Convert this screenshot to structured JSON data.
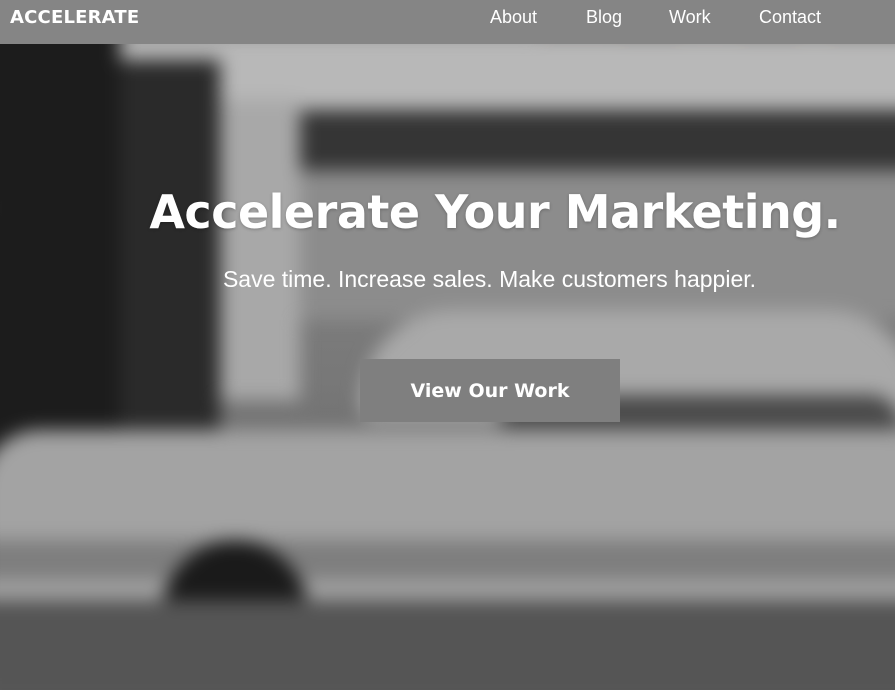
{
  "brand": {
    "name": "ACCELERATE"
  },
  "nav": {
    "items": [
      {
        "label": "About"
      },
      {
        "label": "Blog"
      },
      {
        "label": "Work"
      },
      {
        "label": "Contact"
      }
    ]
  },
  "hero": {
    "title": "Accelerate Your Marketing.",
    "subtitle": "Save time. Increase sales. Make customers happier.",
    "cta_label": "View Our Work"
  },
  "colors": {
    "navbar_bg": "#858585",
    "button_bg": "#7f7f7f",
    "text": "#ffffff"
  }
}
